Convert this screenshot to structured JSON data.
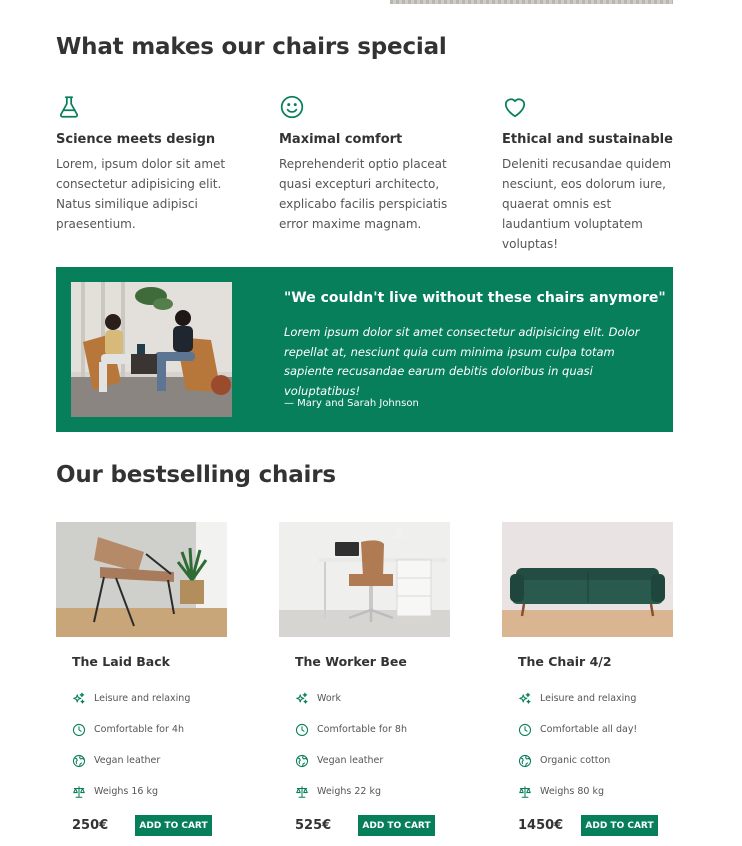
{
  "features_section": {
    "title": "What makes our chairs special",
    "items": [
      {
        "icon": "flask-icon",
        "title": "Science meets design",
        "text": "Lorem, ipsum dolor sit amet consectetur adipisicing elit. Natus similique adipisci praesentium."
      },
      {
        "icon": "smile-icon",
        "title": "Maximal comfort",
        "text": "Reprehenderit optio placeat quasi excepturi architecto, explicabo facilis perspiciatis error maxime magnam."
      },
      {
        "icon": "heart-icon",
        "title": "Ethical and sustainable",
        "text": "Deleniti recusandae quidem nesciunt, eos dolorum iure, quaerat omnis est laudantium voluptatem voluptas!"
      }
    ]
  },
  "testimonial": {
    "quote": "\"We couldn't live without these chairs anymore\"",
    "text": "Lorem ipsum dolor sit amet consectetur adipisicing elit. Dolor repellat at, nesciunt quia cum minima ipsum culpa totam sapiente recusandae earum debitis doloribus in quasi voluptatibus!",
    "author": "— Mary and Sarah Johnson"
  },
  "bestsellers": {
    "title": "Our bestselling chairs",
    "products": [
      {
        "name": "The Laid Back",
        "attributes": [
          {
            "icon": "sparkles-icon",
            "text": "Leisure and relaxing"
          },
          {
            "icon": "clock-icon",
            "text": "Comfortable for 4h"
          },
          {
            "icon": "globe-icon",
            "text": "Vegan leather"
          },
          {
            "icon": "scale-icon",
            "text": "Weighs 16 kg"
          }
        ],
        "price": "250€",
        "cart_label": "ADD TO CART"
      },
      {
        "name": "The Worker Bee",
        "attributes": [
          {
            "icon": "sparkles-icon",
            "text": "Work"
          },
          {
            "icon": "clock-icon",
            "text": "Comfortable for 8h"
          },
          {
            "icon": "globe-icon",
            "text": "Vegan leather"
          },
          {
            "icon": "scale-icon",
            "text": "Weighs 22 kg"
          }
        ],
        "price": "525€",
        "cart_label": "ADD TO CART"
      },
      {
        "name": "The Chair 4/2",
        "attributes": [
          {
            "icon": "sparkles-icon",
            "text": "Leisure and relaxing"
          },
          {
            "icon": "clock-icon",
            "text": "Comfortable all day!"
          },
          {
            "icon": "globe-icon",
            "text": "Organic cotton"
          },
          {
            "icon": "scale-icon",
            "text": "Weighs 80 kg"
          }
        ],
        "price": "1450€",
        "cart_label": "ADD TO CART"
      }
    ]
  },
  "colors": {
    "accent": "#087f5b",
    "heading": "#333333",
    "body_text": "#555555"
  }
}
